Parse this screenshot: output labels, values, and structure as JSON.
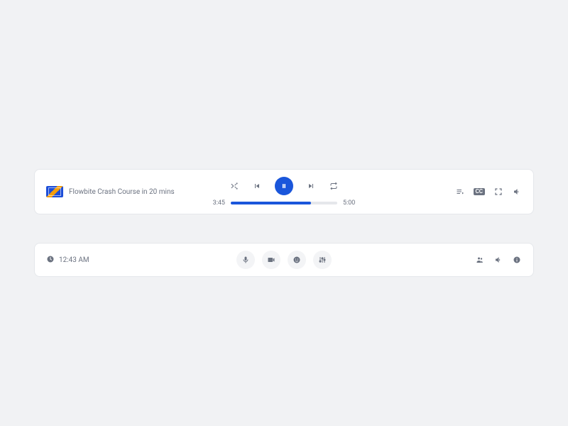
{
  "player": {
    "title": "Flowbite Crash Course in 20 mins",
    "elapsed": "3:45",
    "total": "5:00",
    "progress_pct": 75,
    "cc_label": "CC"
  },
  "call": {
    "time": "12:43 AM"
  }
}
